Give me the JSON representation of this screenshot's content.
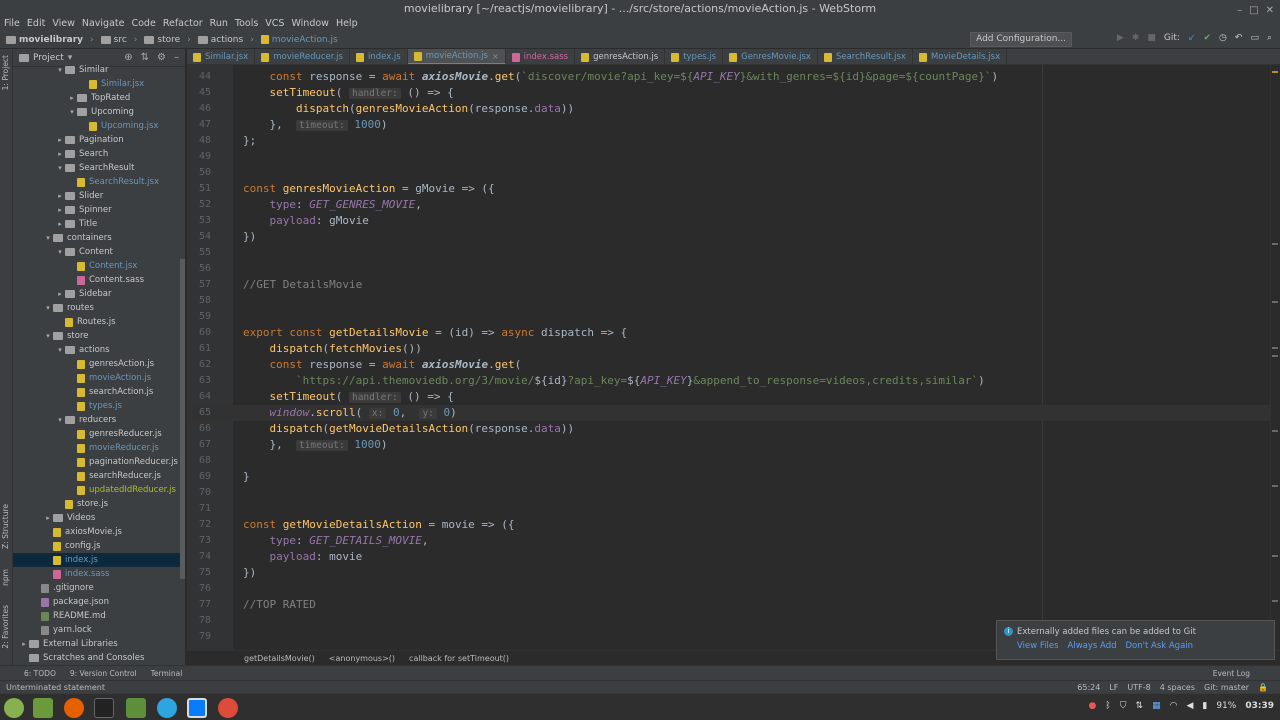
{
  "window": {
    "title": "movielibrary [~/reactjs/movielibrary] - .../src/store/actions/movieAction.js - WebStorm",
    "controls": [
      "–",
      "□",
      "✕"
    ]
  },
  "menu": [
    "File",
    "Edit",
    "View",
    "Navigate",
    "Code",
    "Refactor",
    "Run",
    "Tools",
    "VCS",
    "Window",
    "Help"
  ],
  "breadcrumb": [
    "movielibrary",
    "src",
    "store",
    "actions",
    "movieAction.js"
  ],
  "toolbar": {
    "add_configuration": "Add Configuration...",
    "git_label": "Git:"
  },
  "sidebar": {
    "strip_labels": {
      "project": "1: Project",
      "structure": "Z: Structure",
      "npm": "npm",
      "favorites": "2: Favorites"
    },
    "panel_title": "Project",
    "tree": [
      {
        "label": "Similar",
        "depth": 3,
        "arrow": "▾",
        "icon": "folder"
      },
      {
        "label": "Similar.jsx",
        "depth": 5,
        "arrow": "",
        "icon": "js",
        "color": "blue"
      },
      {
        "label": "TopRated",
        "depth": 4,
        "arrow": "▸",
        "icon": "folder"
      },
      {
        "label": "Upcoming",
        "depth": 4,
        "arrow": "▾",
        "icon": "folder"
      },
      {
        "label": "Upcoming.jsx",
        "depth": 5,
        "arrow": "",
        "icon": "js",
        "color": "blue"
      },
      {
        "label": "Pagination",
        "depth": 3,
        "arrow": "▸",
        "icon": "folder"
      },
      {
        "label": "Search",
        "depth": 3,
        "arrow": "▸",
        "icon": "folder"
      },
      {
        "label": "SearchResult",
        "depth": 3,
        "arrow": "▾",
        "icon": "folder"
      },
      {
        "label": "SearchResult.jsx",
        "depth": 4,
        "arrow": "",
        "icon": "js",
        "color": "blue"
      },
      {
        "label": "Slider",
        "depth": 3,
        "arrow": "▸",
        "icon": "folder"
      },
      {
        "label": "Spinner",
        "depth": 3,
        "arrow": "▸",
        "icon": "folder"
      },
      {
        "label": "Title",
        "depth": 3,
        "arrow": "▸",
        "icon": "folder"
      },
      {
        "label": "containers",
        "depth": 2,
        "arrow": "▾",
        "icon": "folder"
      },
      {
        "label": "Content",
        "depth": 3,
        "arrow": "▾",
        "icon": "folder"
      },
      {
        "label": "Content.jsx",
        "depth": 4,
        "arrow": "",
        "icon": "js",
        "color": "blue"
      },
      {
        "label": "Content.sass",
        "depth": 4,
        "arrow": "",
        "icon": "sass"
      },
      {
        "label": "Sidebar",
        "depth": 3,
        "arrow": "▸",
        "icon": "folder"
      },
      {
        "label": "routes",
        "depth": 2,
        "arrow": "▾",
        "icon": "folder"
      },
      {
        "label": "Routes.js",
        "depth": 3,
        "arrow": "",
        "icon": "js"
      },
      {
        "label": "store",
        "depth": 2,
        "arrow": "▾",
        "icon": "folder"
      },
      {
        "label": "actions",
        "depth": 3,
        "arrow": "▾",
        "icon": "folder"
      },
      {
        "label": "genresAction.js",
        "depth": 4,
        "arrow": "",
        "icon": "js"
      },
      {
        "label": "movieAction.js",
        "depth": 4,
        "arrow": "",
        "icon": "js",
        "color": "blue"
      },
      {
        "label": "searchAction.js",
        "depth": 4,
        "arrow": "",
        "icon": "js"
      },
      {
        "label": "types.js",
        "depth": 4,
        "arrow": "",
        "icon": "js",
        "color": "blue"
      },
      {
        "label": "reducers",
        "depth": 3,
        "arrow": "▾",
        "icon": "folder"
      },
      {
        "label": "genresReducer.js",
        "depth": 4,
        "arrow": "",
        "icon": "js"
      },
      {
        "label": "movieReducer.js",
        "depth": 4,
        "arrow": "",
        "icon": "js",
        "color": "blue"
      },
      {
        "label": "paginationReducer.js",
        "depth": 4,
        "arrow": "",
        "icon": "js"
      },
      {
        "label": "searchReducer.js",
        "depth": 4,
        "arrow": "",
        "icon": "js"
      },
      {
        "label": "updatedIdReducer.js",
        "depth": 4,
        "arrow": "",
        "icon": "js",
        "color": "olive"
      },
      {
        "label": "store.js",
        "depth": 3,
        "arrow": "",
        "icon": "js"
      },
      {
        "label": "Videos",
        "depth": 2,
        "arrow": "▸",
        "icon": "folder"
      },
      {
        "label": "axiosMovie.js",
        "depth": 2,
        "arrow": "",
        "icon": "js"
      },
      {
        "label": "config.js",
        "depth": 2,
        "arrow": "",
        "icon": "js"
      },
      {
        "label": "index.js",
        "depth": 2,
        "arrow": "",
        "icon": "js",
        "color": "blue",
        "selected": true
      },
      {
        "label": "index.sass",
        "depth": 2,
        "arrow": "",
        "icon": "sass",
        "color": "blue"
      },
      {
        "label": ".gitignore",
        "depth": 1,
        "arrow": "",
        "icon": "git"
      },
      {
        "label": "package.json",
        "depth": 1,
        "arrow": "",
        "icon": "json"
      },
      {
        "label": "README.md",
        "depth": 1,
        "arrow": "",
        "icon": "md"
      },
      {
        "label": "yarn.lock",
        "depth": 1,
        "arrow": "",
        "icon": "git"
      },
      {
        "label": "External Libraries",
        "depth": 0,
        "arrow": "▸",
        "icon": "folder"
      },
      {
        "label": "Scratches and Consoles",
        "depth": 0,
        "arrow": "",
        "icon": "folder"
      }
    ]
  },
  "tabs": [
    {
      "label": "Similar.jsx",
      "kind": "js"
    },
    {
      "label": "movieReducer.js",
      "kind": "js"
    },
    {
      "label": "index.js",
      "kind": "js"
    },
    {
      "label": "movieAction.js",
      "kind": "js",
      "active": true
    },
    {
      "label": "index.sass",
      "kind": "sass"
    },
    {
      "label": "genresAction.js",
      "kind": "plain"
    },
    {
      "label": "types.js",
      "kind": "js"
    },
    {
      "label": "GenresMovie.jsx",
      "kind": "js"
    },
    {
      "label": "SearchResult.jsx",
      "kind": "js"
    },
    {
      "label": "MovieDetails.jsx",
      "kind": "js"
    }
  ],
  "code": {
    "current_line": 65,
    "lines": [
      {
        "n": 44,
        "html": "    <span class='kw'>const</span> response = <span class='kw'>await</span> <span class='itf'>axiosMovie</span>.<span class='fn'>get</span>(<span class='str'>`discover/movie?api_key=${<span class='const'>API_KEY</span>}&amp;with_genres=${id}&amp;page=${countPage}`</span>)"
      },
      {
        "n": 45,
        "html": "    <span class='fn'>setTimeout</span>( <span class='hint'>handler:</span> () =&gt; {"
      },
      {
        "n": 46,
        "html": "        <span class='fn'>dispatch</span>(<span class='fn'>genresMovieAction</span>(response.<span class='prm'>data</span>))"
      },
      {
        "n": 47,
        "html": "    },  <span class='hint'>timeout:</span> <span class='num'>1000</span>)"
      },
      {
        "n": 48,
        "html": "};"
      },
      {
        "n": 49,
        "html": ""
      },
      {
        "n": 50,
        "html": ""
      },
      {
        "n": 51,
        "html": "<span class='kw'>const</span> <span class='fn'>genresMovieAction</span> = gMovie =&gt; ({"
      },
      {
        "n": 52,
        "html": "    <span class='prm'>type</span>: <span class='const'>GET_GENRES_MOVIE</span>,"
      },
      {
        "n": 53,
        "html": "    <span class='prm'>payload</span>: gMovie"
      },
      {
        "n": 54,
        "html": "})"
      },
      {
        "n": 55,
        "html": ""
      },
      {
        "n": 56,
        "html": ""
      },
      {
        "n": 57,
        "html": "<span class='cmt'>//GET DetailsMovie</span>"
      },
      {
        "n": 58,
        "html": ""
      },
      {
        "n": 59,
        "html": ""
      },
      {
        "n": 60,
        "html": "<span class='kw'>export const</span> <span class='fn'>getDetailsMovie</span> = (id) =&gt; <span class='kw'>async</span> dispatch =&gt; {"
      },
      {
        "n": 61,
        "html": "    <span class='fn'>dispatch</span>(<span class='fn'>fetchMovies</span>())"
      },
      {
        "n": 62,
        "html": "    <span class='kw'>const</span> response = <span class='kw'>await</span> <span class='itf'>axiosMovie</span>.<span class='fn'>get</span>("
      },
      {
        "n": 63,
        "html": "        <span class='str'>`https://api.themoviedb.org/3/movie/</span>${id}<span class='str'>?api_key=</span>${<span class='const'>API_KEY</span>}<span class='str'>&amp;append_to_response=videos,credits,similar`</span>)"
      },
      {
        "n": 64,
        "html": "    <span class='fn'>setTimeout</span>( <span class='hint'>handler:</span> () =&gt; {"
      },
      {
        "n": 65,
        "html": "    <span class='const'>window</span>.<span class='fn'>scroll</span>( <span class='hint'>x:</span> <span class='num'>0</span>,  <span class='hint'>y:</span> <span class='num'>0</span>)"
      },
      {
        "n": 66,
        "html": "    <span class='fn'>dispatch</span>(<span class='fn'>getMovieDetailsAction</span>(response.<span class='prm'>data</span>))"
      },
      {
        "n": 67,
        "html": "    },  <span class='hint'>timeout:</span> <span class='num'>1000</span>)"
      },
      {
        "n": 68,
        "html": ""
      },
      {
        "n": 69,
        "html": "}"
      },
      {
        "n": 70,
        "html": ""
      },
      {
        "n": 71,
        "html": ""
      },
      {
        "n": 72,
        "html": "<span class='kw'>const</span> <span class='fn'>getMovieDetailsAction</span> = movie =&gt; ({"
      },
      {
        "n": 73,
        "html": "    <span class='prm'>type</span>: <span class='const'>GET_DETAILS_MOVIE</span>,"
      },
      {
        "n": 74,
        "html": "    <span class='prm'>payload</span>: movie"
      },
      {
        "n": 75,
        "html": "})"
      },
      {
        "n": 76,
        "html": ""
      },
      {
        "n": 77,
        "html": "<span class='cmt'>//TOP RATED</span>"
      },
      {
        "n": 78,
        "html": ""
      },
      {
        "n": 79,
        "html": ""
      }
    ]
  },
  "editor_breadcrumb": [
    "getDetailsMovie()",
    "<anonymous>()",
    "callback for setTimeout()"
  ],
  "notification": {
    "title": "Externally added files can be added to Git",
    "actions": [
      "View Files",
      "Always Add",
      "Don't Ask Again"
    ]
  },
  "toolwindows": {
    "todo": "6: TODO",
    "vcs": "9: Version Control",
    "terminal": "Terminal",
    "event_log": "Event Log"
  },
  "status": {
    "message": "Unterminated statement",
    "position": "65:24",
    "line_sep": "LF",
    "encoding": "UTF-8",
    "indent": "4 spaces",
    "git": "Git: master"
  },
  "taskbar": {
    "battery": "91%",
    "time": "03:39"
  }
}
